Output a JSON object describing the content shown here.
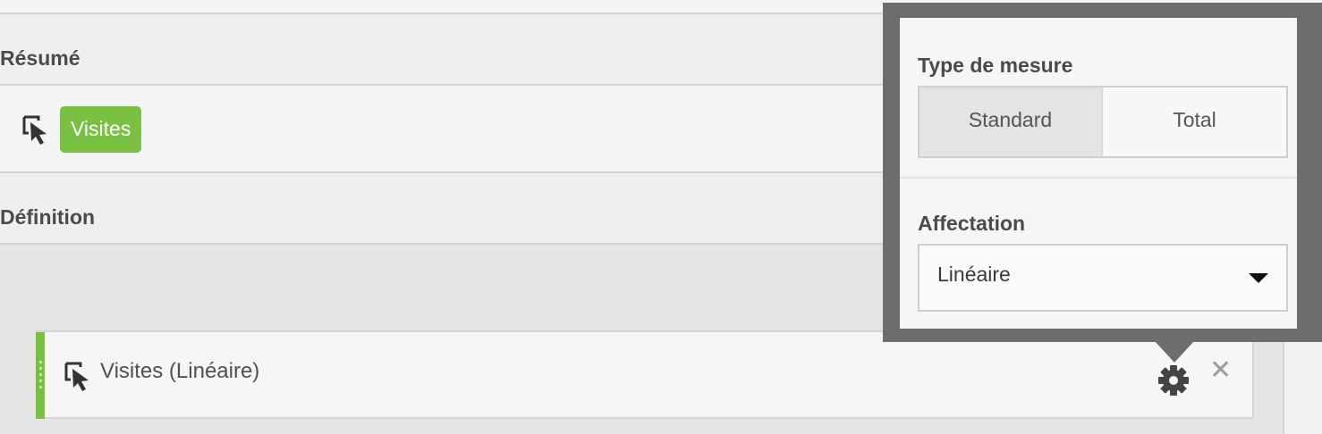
{
  "summary": {
    "heading": "Résumé",
    "badge": "Visites",
    "icon": "cursor-icon"
  },
  "definition": {
    "heading": "Définition",
    "metric_label": "Visites (Linéaire)",
    "icons": [
      "cursor-icon",
      "gear-icon",
      "close-icon"
    ]
  },
  "popover": {
    "type_label": "Type de mesure",
    "segments": [
      {
        "label": "Standard",
        "selected": true
      },
      {
        "label": "Total",
        "selected": false
      }
    ],
    "allocation_label": "Affectation",
    "allocation_value": "Linéaire"
  },
  "colors": {
    "accent_green": "#7ac143",
    "popover_frame": "#6d6d6d"
  }
}
